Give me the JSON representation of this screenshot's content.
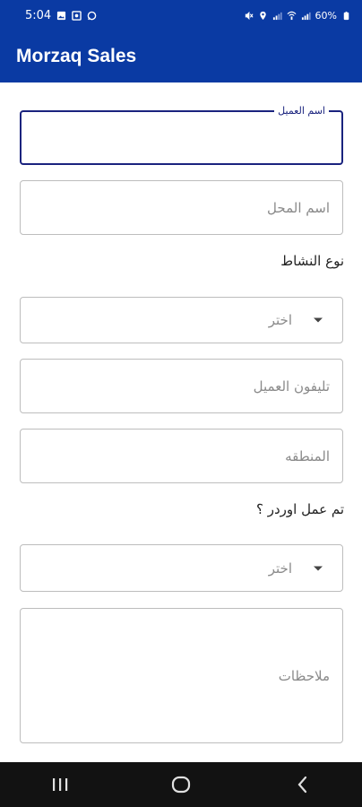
{
  "status_bar": {
    "time": "5:04",
    "battery": "60%"
  },
  "app": {
    "title": "Morzaq Sales"
  },
  "form": {
    "customer_name": {
      "label": "اسم العميل",
      "value": ""
    },
    "shop_name": {
      "placeholder": "اسم المحل"
    },
    "activity_type": {
      "label": "نوع النشاط",
      "selected": "اختر"
    },
    "customer_phone": {
      "placeholder": "تليفون العميل"
    },
    "region": {
      "placeholder": "المنطقه"
    },
    "order_made": {
      "label": "تم عمل اوردر ؟",
      "selected": "اختر"
    },
    "notes": {
      "placeholder": "ملاحظات"
    }
  },
  "icons": {
    "recents": "recents-icon",
    "home": "home-icon",
    "back": "back-icon"
  },
  "colors": {
    "primary": "#0a3aa3",
    "focus": "#1a237e",
    "nav_bar": "#121212"
  }
}
